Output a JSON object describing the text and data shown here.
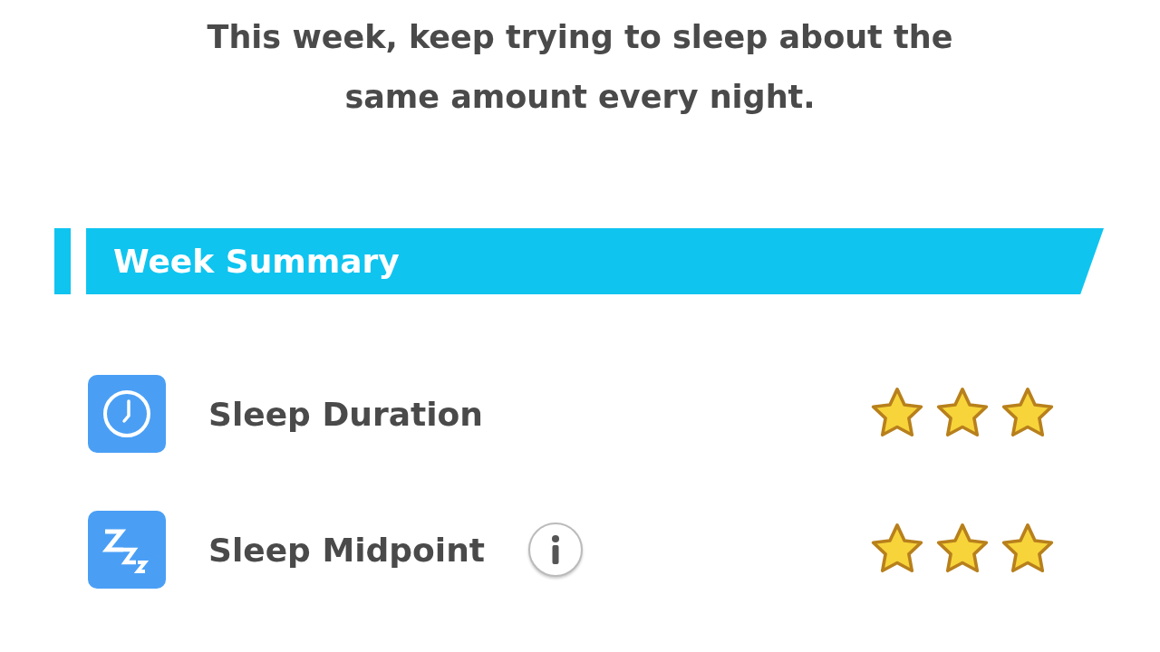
{
  "message": "This week, keep trying to sleep about the same amount every night.",
  "section": {
    "title": "Week Summary"
  },
  "rows": [
    {
      "kind": "clock",
      "label": "Sleep Duration",
      "info": false,
      "stars": 3
    },
    {
      "kind": "sleep",
      "label": "Sleep Midpoint",
      "info": true,
      "stars": 3
    }
  ]
}
